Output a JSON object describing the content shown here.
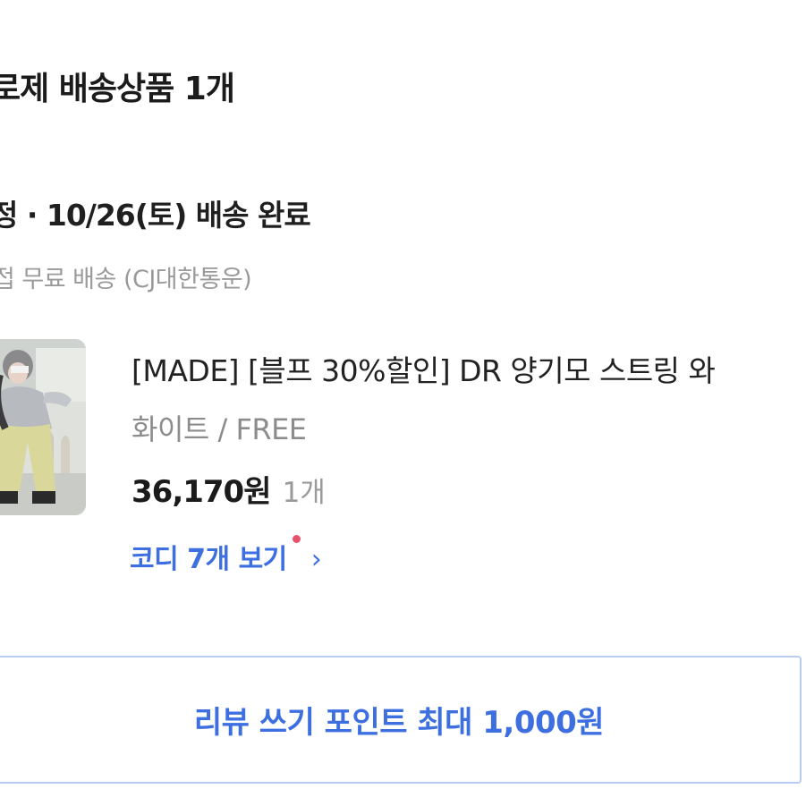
{
  "order_group": {
    "title": "로제 배송상품 1개"
  },
  "delivery": {
    "status": "정 · 10/26(토) 배송 완료",
    "method": "접 무료 배송 (CJ대한통운)"
  },
  "product": {
    "name": "[MADE] [블프 30%할인] DR 양기모 스트링 와",
    "option": "화이트 / FREE",
    "price": "36,170원",
    "quantity": "1개",
    "codi_link": "코디 7개 보기",
    "chevron": "›"
  },
  "review": {
    "label": "리뷰 쓰기 포인트 최대 1,000원"
  },
  "colors": {
    "accent_blue": "#3d6fe0",
    "button_border": "#b9cdf2",
    "new_dot": "#e8526a"
  }
}
